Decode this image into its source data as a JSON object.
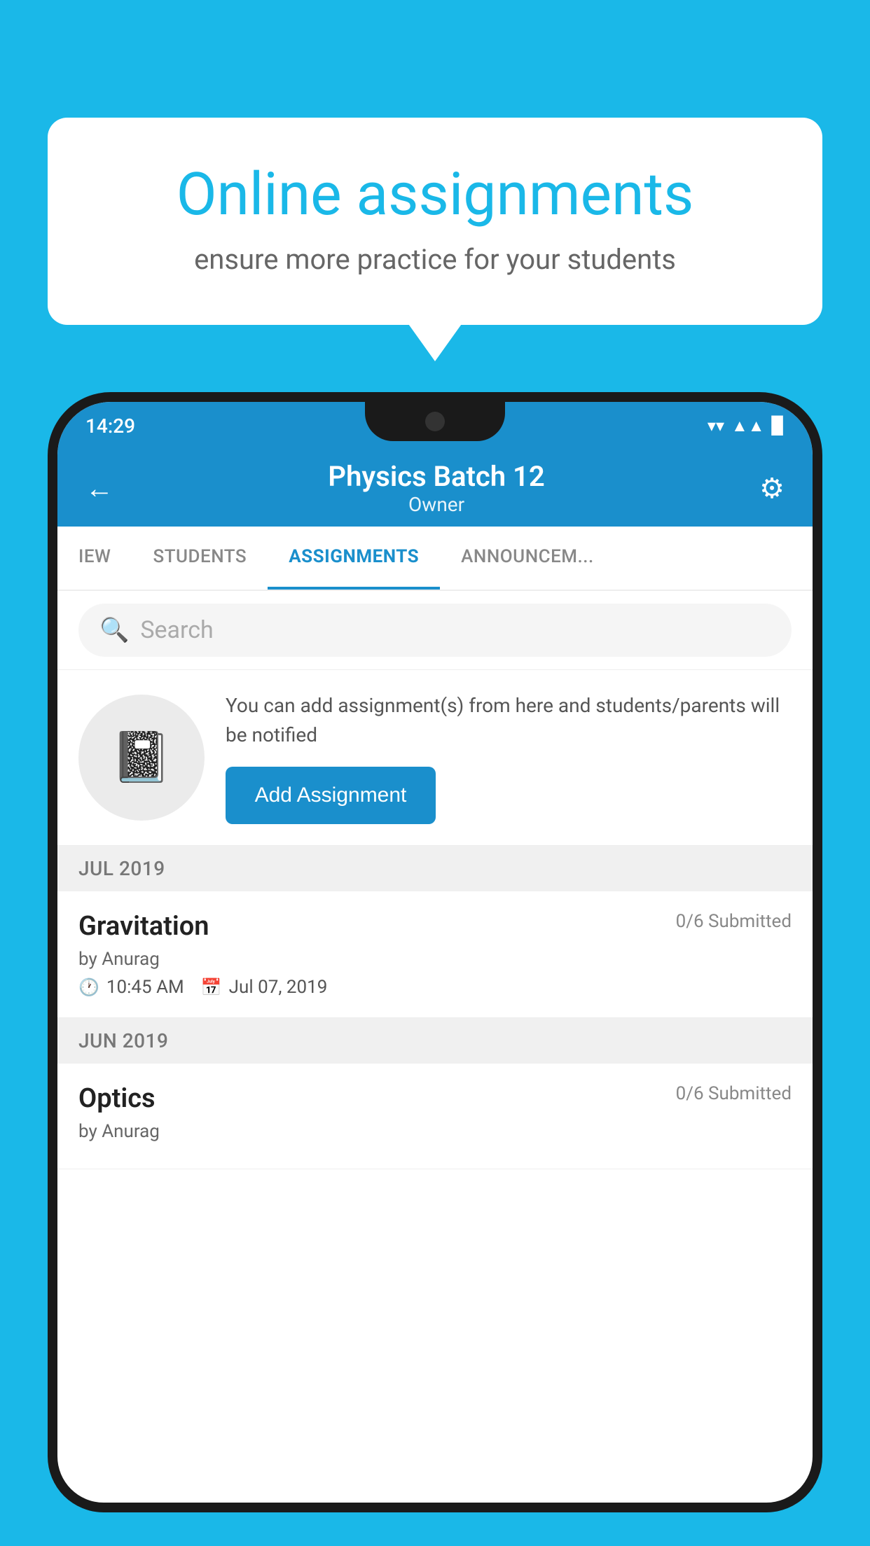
{
  "background": {
    "color": "#1AB8E8"
  },
  "speech_bubble": {
    "title": "Online assignments",
    "subtitle": "ensure more practice for your students"
  },
  "status_bar": {
    "time": "14:29",
    "wifi": "▼",
    "signal": "▲",
    "battery": "▉"
  },
  "header": {
    "title": "Physics Batch 12",
    "subtitle": "Owner",
    "back_label": "←",
    "settings_label": "⚙"
  },
  "tabs": [
    {
      "label": "IEW",
      "active": false
    },
    {
      "label": "STUDENTS",
      "active": false
    },
    {
      "label": "ASSIGNMENTS",
      "active": true
    },
    {
      "label": "ANNOUNCEM...",
      "active": false
    }
  ],
  "search": {
    "placeholder": "Search"
  },
  "add_assignment": {
    "description": "You can add assignment(s) from here and students/parents will be notified",
    "button_label": "Add Assignment"
  },
  "sections": [
    {
      "label": "JUL 2019",
      "items": [
        {
          "name": "Gravitation",
          "submitted": "0/6 Submitted",
          "author": "by Anurag",
          "time": "10:45 AM",
          "date": "Jul 07, 2019"
        }
      ]
    },
    {
      "label": "JUN 2019",
      "items": [
        {
          "name": "Optics",
          "submitted": "0/6 Submitted",
          "author": "by Anurag",
          "time": "",
          "date": ""
        }
      ]
    }
  ]
}
